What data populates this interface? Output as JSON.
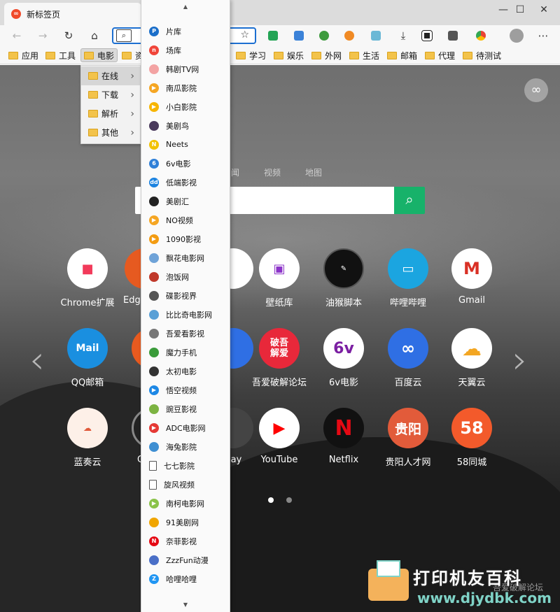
{
  "browser": {
    "tab_title": "新标签页",
    "window": {
      "minimize": "—",
      "maximize": "☐",
      "close": "✕"
    },
    "toolbar": {
      "back": "←",
      "forward": "→",
      "reload": "↻",
      "home": "⌂",
      "search_glyph": "⌕",
      "star": "☆",
      "download": "⤓",
      "more": "⋯"
    },
    "bookmarks": [
      {
        "label": "应用"
      },
      {
        "label": "工具"
      },
      {
        "label": "电影",
        "active": true
      },
      {
        "label": "资"
      },
      {
        "label": "学习"
      },
      {
        "label": "娱乐"
      },
      {
        "label": "外网"
      },
      {
        "label": "生活"
      },
      {
        "label": "邮箱"
      },
      {
        "label": "代理"
      },
      {
        "label": "待测试"
      }
    ]
  },
  "submenu": [
    {
      "label": "在线",
      "hot": true
    },
    {
      "label": "下载"
    },
    {
      "label": "解析"
    },
    {
      "label": "其他"
    }
  ],
  "dropdown": {
    "scroll_up": "▲",
    "scroll_down": "▼",
    "items": [
      {
        "label": "片库",
        "icon": "p-icon",
        "color": "#1a6ec9",
        "glyph": "P"
      },
      {
        "label": "场库",
        "icon": "new-icon",
        "color": "#f0453a",
        "glyph": "n"
      },
      {
        "label": "韩剧TV网",
        "icon": "ring-icon",
        "color": "#f3a3a3",
        "glyph": ""
      },
      {
        "label": "南瓜影院",
        "icon": "play-icon",
        "color": "#f5a623",
        "glyph": "▶"
      },
      {
        "label": "小白影院",
        "icon": "play-icon",
        "color": "#f7b500",
        "glyph": "▶"
      },
      {
        "label": "美剧鸟",
        "icon": "bird-icon",
        "color": "#4a3a5c",
        "glyph": ""
      },
      {
        "label": "Neets",
        "icon": "neets-icon",
        "color": "#f2c200",
        "glyph": "N"
      },
      {
        "label": "6v电影",
        "icon": "6v-icon",
        "color": "#2f80d8",
        "glyph": "6"
      },
      {
        "label": "低端影视",
        "icon": "dd-icon",
        "color": "#1a82e0",
        "glyph": "dd"
      },
      {
        "label": "美剧汇",
        "icon": "mjh-icon",
        "color": "#222222",
        "glyph": ""
      },
      {
        "label": "NO视频",
        "icon": "play-icon",
        "color": "#f5a623",
        "glyph": "▶"
      },
      {
        "label": "1090影视",
        "icon": "play-icon",
        "color": "#f39c12",
        "glyph": "▶"
      },
      {
        "label": "飘花电影网",
        "icon": "flower-icon",
        "color": "#6fa3d8",
        "glyph": ""
      },
      {
        "label": "泡饭网",
        "icon": "film-icon",
        "color": "#c0392b",
        "glyph": ""
      },
      {
        "label": "碟影视界",
        "icon": "disc-icon",
        "color": "#555555",
        "glyph": ""
      },
      {
        "label": "比比奇电影网",
        "icon": "bbq-icon",
        "color": "#5aa0d6",
        "glyph": ""
      },
      {
        "label": "吾爱看影视",
        "icon": "reel-icon",
        "color": "#777777",
        "glyph": ""
      },
      {
        "label": "魔力手机",
        "icon": "leaf-icon",
        "color": "#3a9b3a",
        "glyph": ""
      },
      {
        "label": "太初电影",
        "icon": "taichu-icon",
        "color": "#333333",
        "glyph": ""
      },
      {
        "label": "悟空视频",
        "icon": "play-icon",
        "color": "#1e88e5",
        "glyph": "▶"
      },
      {
        "label": "豌豆影视",
        "icon": "android-icon",
        "color": "#7cb342",
        "glyph": ""
      },
      {
        "label": "ADC电影网",
        "icon": "adc-icon",
        "color": "#e53935",
        "glyph": "▶"
      },
      {
        "label": "海兔影院",
        "icon": "bunny-icon",
        "color": "#3f8fd2",
        "glyph": ""
      },
      {
        "label": "七七影院",
        "icon": "page-icon",
        "color": "#ffffff",
        "glyph": ""
      },
      {
        "label": "旋风视频",
        "icon": "page-icon",
        "color": "#ffffff",
        "glyph": ""
      },
      {
        "label": "南柯电影网",
        "icon": "nk-icon",
        "color": "#8bc34a",
        "glyph": "▶"
      },
      {
        "label": "91美剧网",
        "icon": "91-icon",
        "color": "#f0a500",
        "glyph": ""
      },
      {
        "label": "奈菲影视",
        "icon": "netflix-icon",
        "color": "#e50914",
        "glyph": "N"
      },
      {
        "label": "ZzzFun动漫",
        "icon": "zzz-icon",
        "color": "#4a6fc7",
        "glyph": ""
      },
      {
        "label": "哈哩哈哩",
        "icon": "z-icon",
        "color": "#2196f3",
        "glyph": "Z"
      }
    ]
  },
  "newtab": {
    "infinity": "∞",
    "search_tabs": [
      "闻",
      "视频",
      "地图"
    ],
    "search_button": "⌕",
    "arrows": {
      "left": "‹",
      "right": "›"
    },
    "apps": [
      {
        "label": "Chrome扩展",
        "icon": "bag-icon",
        "bg": "#ffffff",
        "fg": "#f23a5a",
        "glyph": "🛍"
      },
      {
        "label": "Edg",
        "icon": "edge-icon",
        "bg": "#e65a20",
        "fg": "#ffffff",
        "glyph": ""
      },
      {
        "label": "壁纸库",
        "icon": "wallpaper-icon",
        "bg": "#ffffff",
        "fg": "#8c34c9",
        "glyph": "▣"
      },
      {
        "label": "油猴脚本",
        "icon": "tampermonkey-icon",
        "bg": "#111111",
        "fg": "#ffffff",
        "glyph": "✎"
      },
      {
        "label": "哔哩哔哩",
        "icon": "bilibili-icon",
        "bg": "#1ba5e0",
        "fg": "#ffffff",
        "glyph": "📺"
      },
      {
        "label": "Gmail",
        "icon": "gmail-icon",
        "bg": "#ffffff",
        "fg": "#d93025",
        "glyph": "M"
      },
      {
        "label": "QQ邮箱",
        "icon": "qqmail-icon",
        "bg": "#1a8fe0",
        "fg": "#ffffff",
        "glyph": "Mail"
      },
      {
        "label": "吾爱破解论坛",
        "icon": "52pojie-icon",
        "bg": "#e8283a",
        "fg": "#ffffff",
        "glyph": "破吾 解爱"
      },
      {
        "label": "6v电影",
        "icon": "6v-icon",
        "bg": "#ffffff",
        "fg": "#7b1fa2",
        "glyph": "6v"
      },
      {
        "label": "百度云",
        "icon": "baiduyun-icon",
        "bg": "#2f6fe4",
        "fg": "#ffffff",
        "glyph": "∞"
      },
      {
        "label": "天翼云",
        "icon": "tianyiyun-icon",
        "bg": "#ffffff",
        "fg": "#f3a622",
        "glyph": "☁"
      },
      {
        "label": "蓝奏云",
        "icon": "lanzou-icon",
        "bg": "#fdf0e8",
        "fg": "#e05a3b",
        "glyph": "☁"
      },
      {
        "label": "YouTube",
        "icon": "youtube-icon",
        "bg": "#ffffff",
        "fg": "#ff0000",
        "glyph": "▶"
      },
      {
        "label": "Netflix",
        "icon": "netflix-icon",
        "bg": "#111111",
        "fg": "#e50914",
        "glyph": "N"
      },
      {
        "label": "贵阳人才网",
        "icon": "guiyang-icon",
        "bg": "#e25b3a",
        "fg": "#ffffff",
        "glyph": "贵阳"
      },
      {
        "label": "58同城",
        "icon": "58-icon",
        "bg": "#f35a2b",
        "fg": "#ffffff",
        "glyph": "58"
      }
    ],
    "partial_labels": {
      "row3_col2": "C",
      "row3_col3": "lay"
    },
    "page_dots": 2
  },
  "watermark": {
    "title": "打印机友百科",
    "url": "www.djydbk.com",
    "faint": "吾爱破解论坛"
  }
}
